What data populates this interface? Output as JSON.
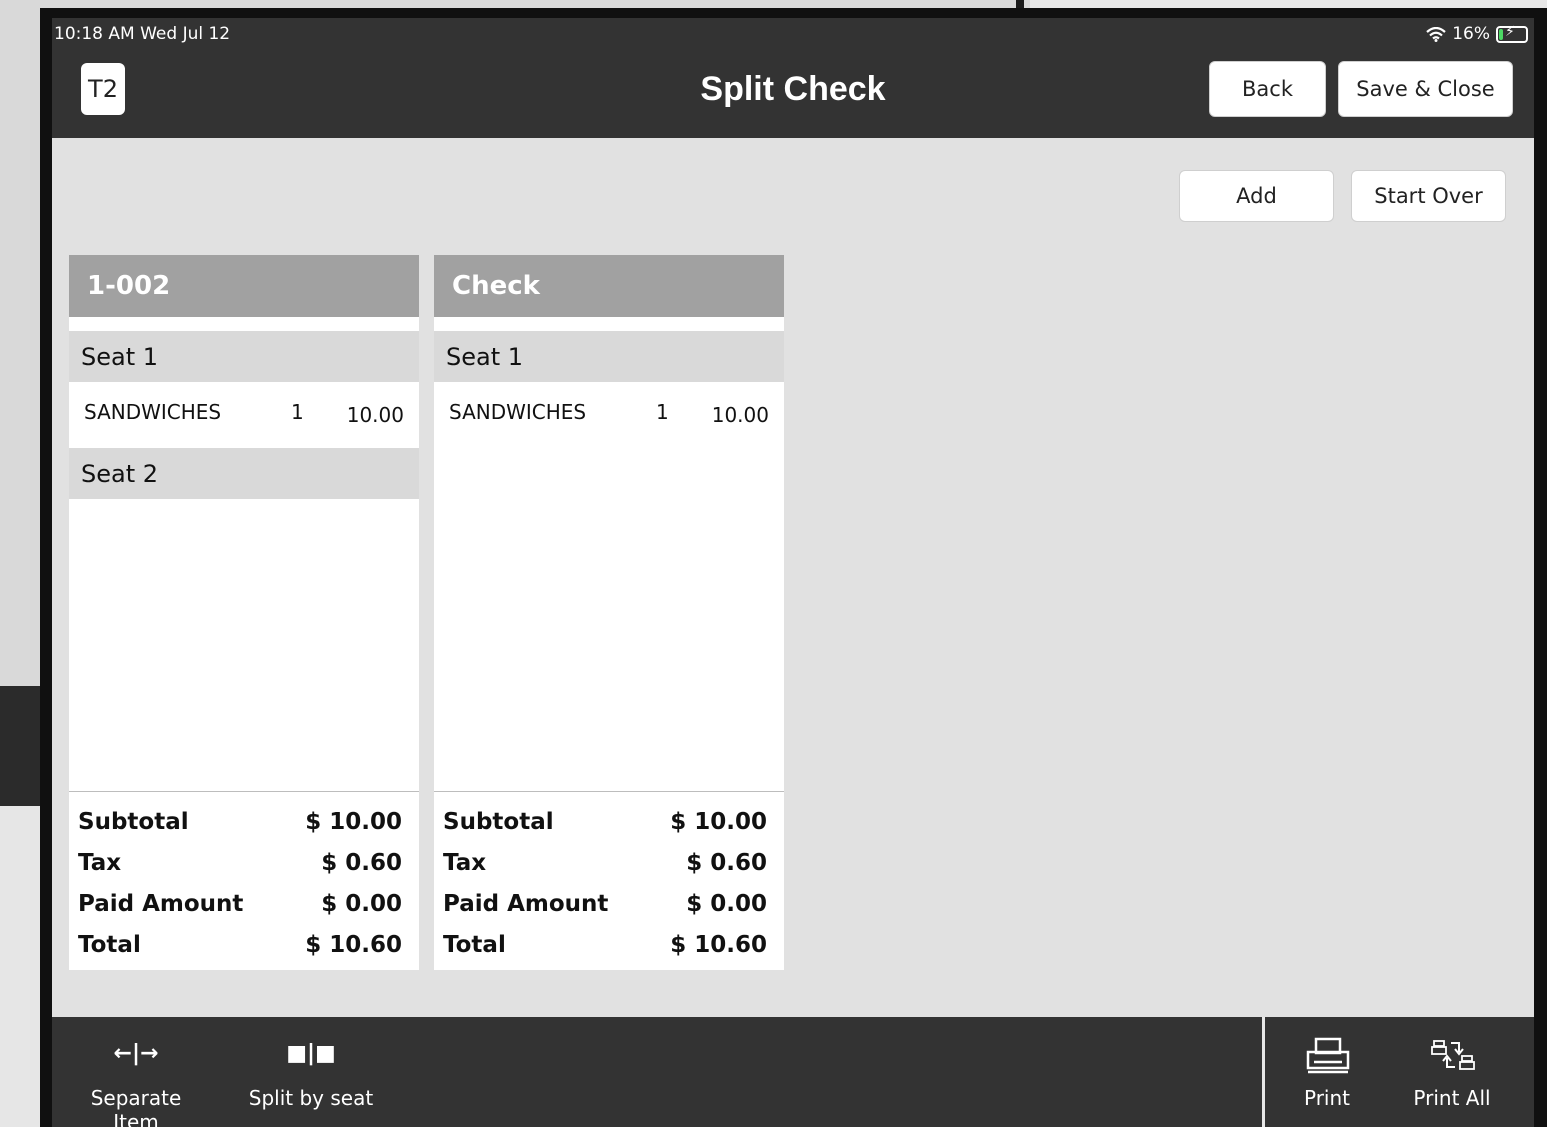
{
  "status": {
    "time": "10:18 AM   Wed Jul 12",
    "battery": "16%",
    "battery_level": 0.16
  },
  "header": {
    "table": "T2",
    "title": "Split Check",
    "back_label": "Back",
    "save_close_label": "Save & Close"
  },
  "actions": {
    "add_label": "Add",
    "start_over_label": "Start Over"
  },
  "checks": [
    {
      "title": "1-002",
      "seats": [
        {
          "label": "Seat 1",
          "items": [
            {
              "name": "SANDWICHES",
              "qty": "1",
              "price": "10.00"
            }
          ]
        },
        {
          "label": "Seat 2",
          "items": []
        }
      ],
      "totals": {
        "subtotal_label": "Subtotal",
        "subtotal": "$ 10.00",
        "tax_label": "Tax",
        "tax": "$ 0.60",
        "paid_label": "Paid Amount",
        "paid": "$ 0.00",
        "total_label": "Total",
        "total": "$ 10.60"
      }
    },
    {
      "title": "Check",
      "seats": [
        {
          "label": "Seat 1",
          "items": [
            {
              "name": "SANDWICHES",
              "qty": "1",
              "price": "10.00"
            }
          ]
        }
      ],
      "totals": {
        "subtotal_label": "Subtotal",
        "subtotal": "$ 10.00",
        "tax_label": "Tax",
        "tax": "$ 0.60",
        "paid_label": "Paid Amount",
        "paid": "$ 0.00",
        "total_label": "Total",
        "total": "$ 10.60"
      }
    }
  ],
  "toolbar": {
    "separate_item": {
      "label": "Separate Item",
      "icon": "←|→"
    },
    "split_by_seat": {
      "label": "Split by seat",
      "icon": "■|■"
    },
    "print": {
      "label": "Print"
    },
    "print_all": {
      "label": "Print All"
    }
  },
  "colors": {
    "bar": "#333333",
    "background": "#e1e1e1",
    "check_header": "#a1a1a1",
    "seat_row": "#d9d9d9",
    "battery_fill": "#4cd964"
  }
}
